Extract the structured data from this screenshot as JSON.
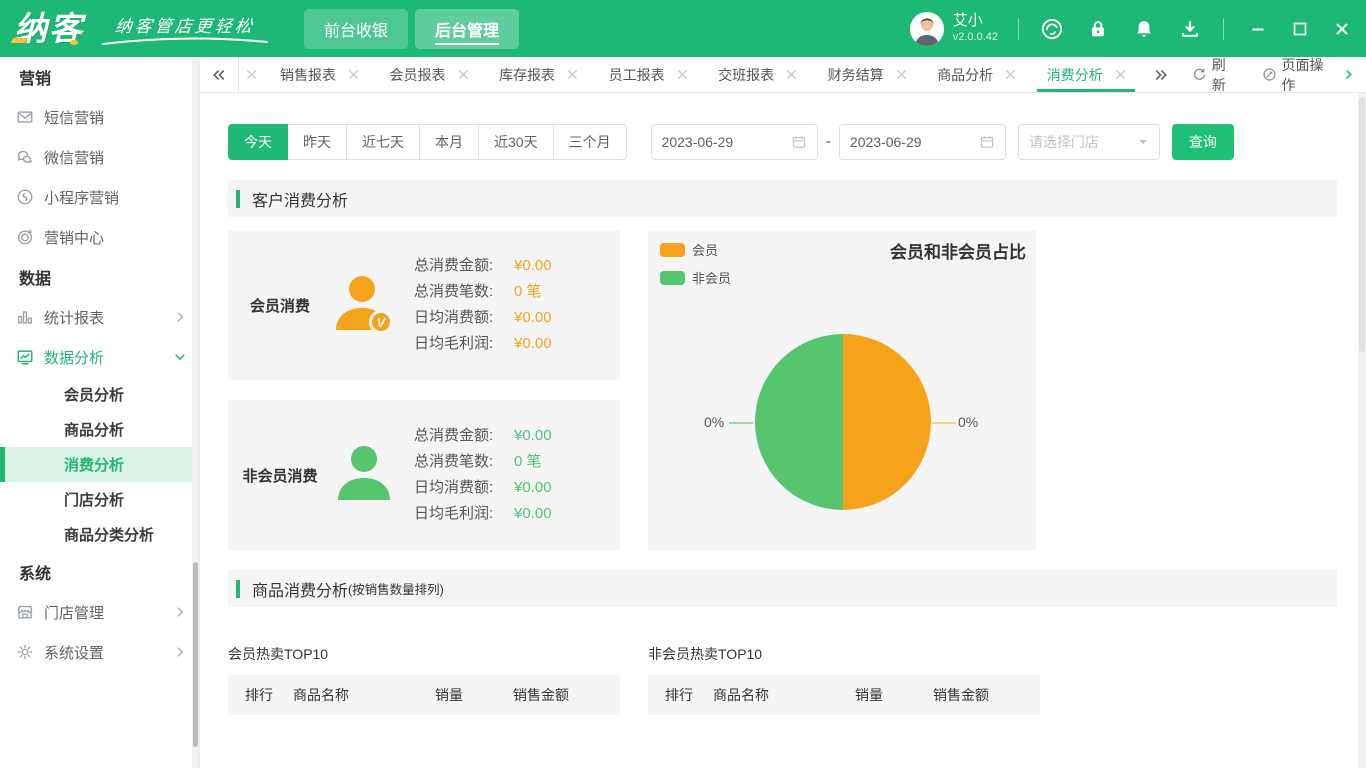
{
  "colors": {
    "brand_green": "#1EB876",
    "accent_green": "#22B573",
    "button_green": "#1FC075",
    "orange": "#F5A31B",
    "pie_green": "#57C56F",
    "yellow_accent": "#F6C433"
  },
  "brand": {
    "logo_text": "纳客",
    "tagline": "纳客管店更轻松"
  },
  "header": {
    "nav": [
      {
        "label": "前台收银"
      },
      {
        "label": "后台管理"
      }
    ],
    "active_nav": "后台管理",
    "user_name": "艾小",
    "version": "v2.0.0.42"
  },
  "tabbar": {
    "tabs": [
      {
        "label": "销售报表"
      },
      {
        "label": "会员报表"
      },
      {
        "label": "库存报表"
      },
      {
        "label": "员工报表"
      },
      {
        "label": "交班报表"
      },
      {
        "label": "财务结算"
      },
      {
        "label": "商品分析"
      },
      {
        "label": "消费分析"
      }
    ],
    "active_tab": "消费分析",
    "refresh_label": "刷新",
    "page_actions_label": "页面操作"
  },
  "sidebar": {
    "sections": [
      {
        "title": "营销",
        "items": [
          {
            "label": "短信营销"
          },
          {
            "label": "微信营销"
          },
          {
            "label": "小程序营销"
          },
          {
            "label": "营销中心"
          }
        ]
      },
      {
        "title": "数据",
        "items": [
          {
            "label": "统计报表"
          },
          {
            "label": "数据分析",
            "children": [
              {
                "label": "会员分析"
              },
              {
                "label": "商品分析"
              },
              {
                "label": "消费分析"
              },
              {
                "label": "门店分析"
              },
              {
                "label": "商品分类分析"
              }
            ]
          }
        ]
      },
      {
        "title": "系统",
        "items": [
          {
            "label": "门店管理"
          },
          {
            "label": "系统设置"
          }
        ]
      }
    ],
    "active_item": "消费分析"
  },
  "filters": {
    "quick_ranges": [
      "今天",
      "昨天",
      "近七天",
      "本月",
      "近30天",
      "三个月"
    ],
    "active_range": "今天",
    "date_from": "2023-06-29",
    "date_separator": "-",
    "date_to": "2023-06-29",
    "store_placeholder": "请选择门店",
    "search_label": "查询"
  },
  "customer_section": {
    "title": "客户消费分析",
    "cards": [
      {
        "name": "会员消费",
        "badge": "V",
        "stats": [
          {
            "label": "总消费金额:",
            "value": "¥0.00"
          },
          {
            "label": "总消费笔数:",
            "value": "0 笔"
          },
          {
            "label": "日均消费额:",
            "value": "¥0.00"
          },
          {
            "label": "日均毛利润:",
            "value": "¥0.00"
          }
        ]
      },
      {
        "name": "非会员消费",
        "stats": [
          {
            "label": "总消费金额:",
            "value": "¥0.00"
          },
          {
            "label": "总消费笔数:",
            "value": "0 笔"
          },
          {
            "label": "日均消费额:",
            "value": "¥0.00"
          },
          {
            "label": "日均毛利润:",
            "value": "¥0.00"
          }
        ]
      }
    ]
  },
  "chart_data": {
    "type": "pie",
    "title": "会员和非会员占比",
    "legend": [
      "会员",
      "非会员"
    ],
    "legend_position": "top-left",
    "slices": [
      {
        "name": "会员",
        "value": 50,
        "percent_label": "0%",
        "color": "#F5A31B",
        "side": "right"
      },
      {
        "name": "非会员",
        "value": 50,
        "percent_label": "0%",
        "color": "#57C56F",
        "side": "left"
      }
    ]
  },
  "product_section": {
    "title": "商品消费分析",
    "subtitle": "(按销售数量排列)",
    "tables": [
      {
        "title": "会员热卖TOP10",
        "columns": [
          "排行",
          "商品名称",
          "销量",
          "销售金额"
        ],
        "rows": []
      },
      {
        "title": "非会员热卖TOP10",
        "columns": [
          "排行",
          "商品名称",
          "销量",
          "销售金额"
        ],
        "rows": []
      }
    ]
  }
}
